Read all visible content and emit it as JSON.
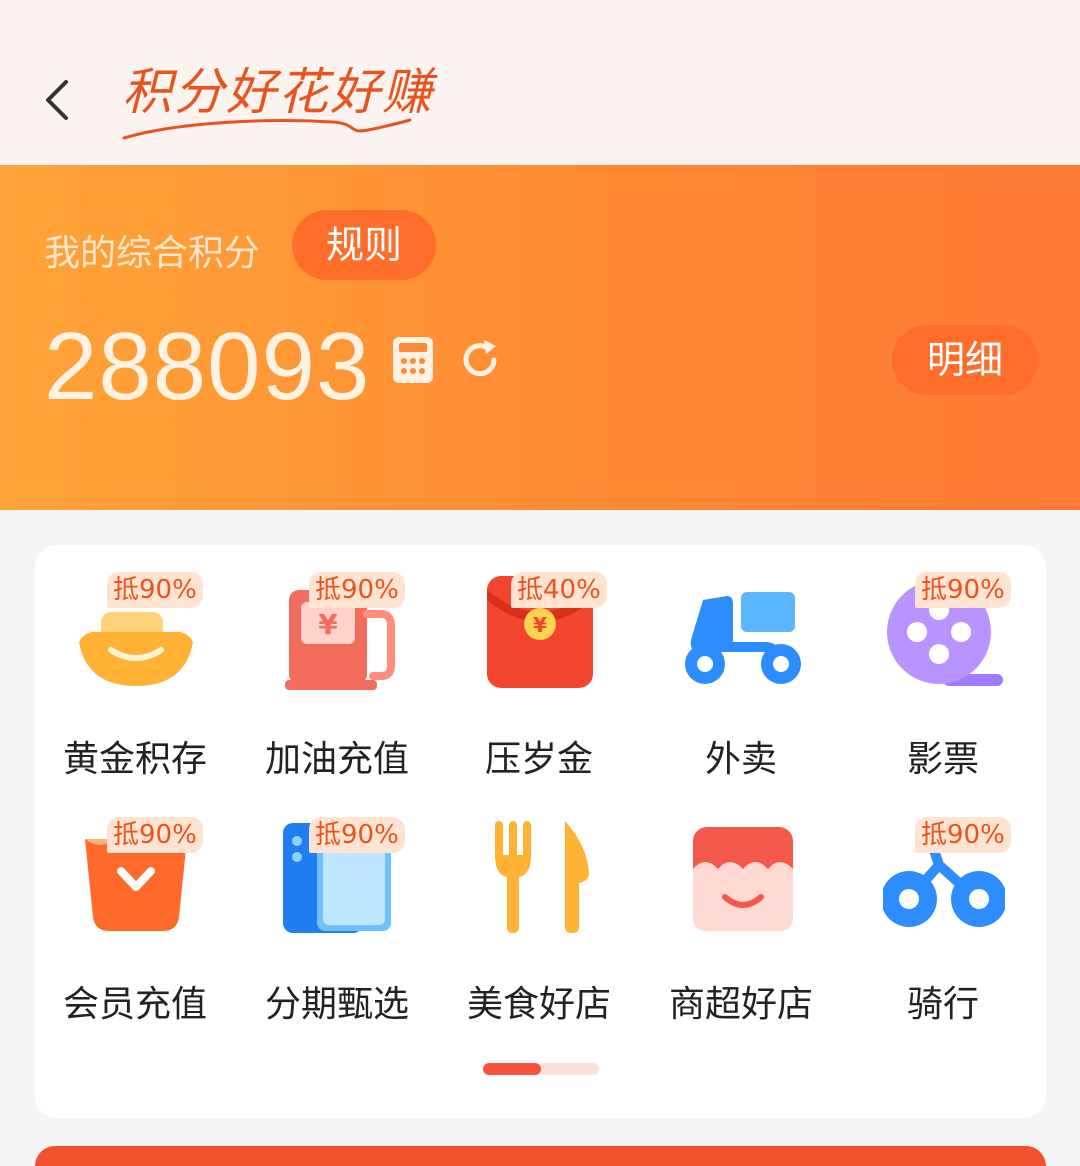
{
  "header": {
    "back_label": "",
    "brand_title": "积分好花好赚"
  },
  "hero": {
    "points_label": "我的综合积分",
    "rule_button": "规则",
    "points_value": "288093",
    "detail_button": "明细"
  },
  "colors": {
    "accent": "#ff6d2a",
    "hero_start": "#ffa438",
    "hero_end": "#ff7a35",
    "tag_text": "#e8541e",
    "tag_bg": "#ffe3d2"
  },
  "services": [
    {
      "label": "黄金积存",
      "tag": "抵90%",
      "icon": "gold-ingot-icon"
    },
    {
      "label": "加油充值",
      "tag": "抵90%",
      "icon": "fuel-pump-icon"
    },
    {
      "label": "压岁金",
      "tag": "抵40%",
      "icon": "red-envelope-icon"
    },
    {
      "label": "外卖",
      "tag": "",
      "icon": "scooter-icon"
    },
    {
      "label": "影票",
      "tag": "抵90%",
      "icon": "film-reel-icon"
    },
    {
      "label": "会员充值",
      "tag": "抵90%",
      "icon": "vip-basket-icon"
    },
    {
      "label": "分期甄选",
      "tag": "抵90%",
      "icon": "phone-icon"
    },
    {
      "label": "美食好店",
      "tag": "",
      "icon": "fork-knife-icon"
    },
    {
      "label": "商超好店",
      "tag": "",
      "icon": "store-icon"
    },
    {
      "label": "骑行",
      "tag": "抵90%",
      "icon": "bicycle-icon"
    }
  ],
  "pager": {
    "current_page": 1,
    "total_pages": 2
  }
}
